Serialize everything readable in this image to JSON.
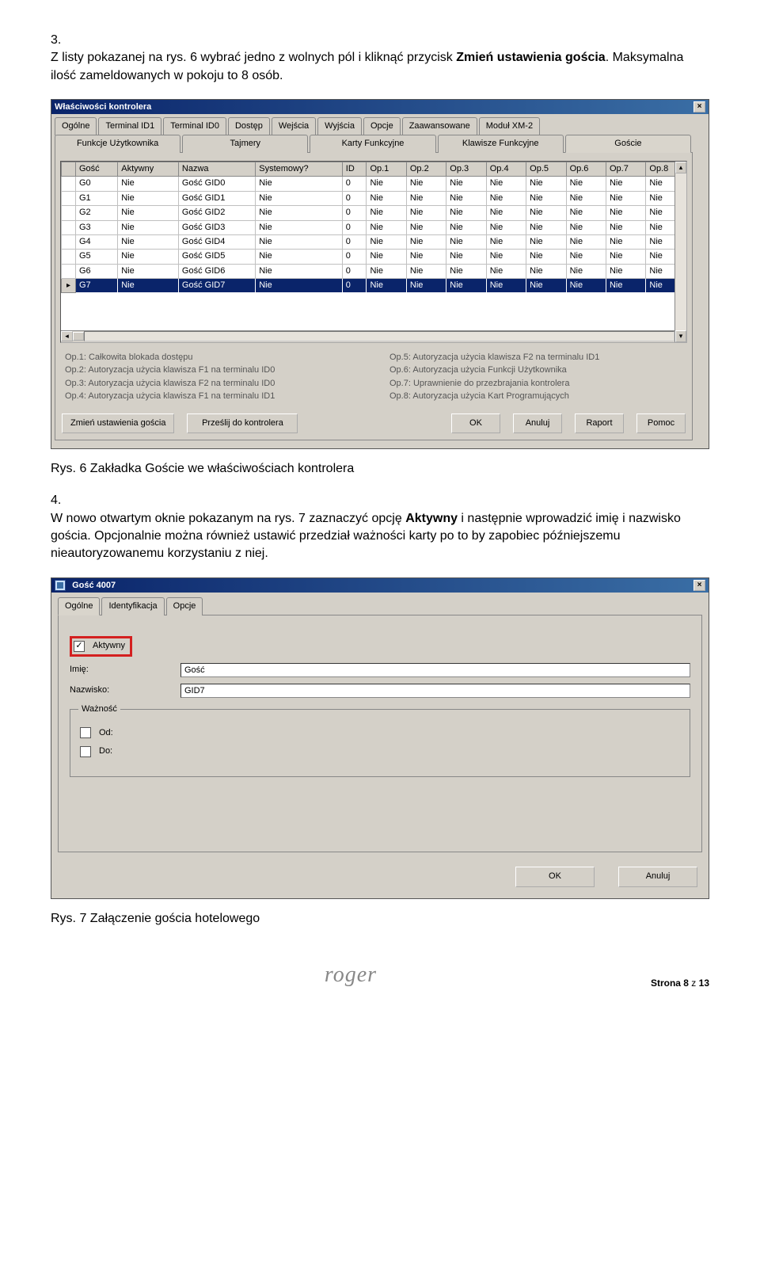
{
  "instr3": {
    "num": "3.",
    "text_a": "Z listy pokazanej na rys. 6 wybrać jedno z wolnych pól i kliknąć przycisk ",
    "bold": "Zmień ustawienia gościa",
    "text_b": ". Maksymalna ilość zameldowanych w pokoju to 8 osób."
  },
  "win1": {
    "title": "Właściwości kontrolera",
    "tabs_row1": [
      "Ogólne",
      "Terminal ID1",
      "Terminal ID0",
      "Dostęp",
      "Wejścia",
      "Wyjścia",
      "Opcje",
      "Zaawansowane",
      "Moduł XM-2"
    ],
    "tabs_row2": [
      "Funkcje Użytkownika",
      "Tajmery",
      "Karty Funkcyjne",
      "Klawisze Funkcyjne",
      "Goście"
    ],
    "active_tab": "Goście",
    "headers": [
      "",
      "Gość",
      "Aktywny",
      "Nazwa",
      "Systemowy?",
      "ID",
      "Op.1",
      "Op.2",
      "Op.3",
      "Op.4",
      "Op.5",
      "Op.6",
      "Op.7",
      "Op.8"
    ],
    "rows": [
      {
        "mark": "",
        "g": "G0",
        "a": "Nie",
        "n": "Gość GID0",
        "s": "Nie",
        "id": "0",
        "ops": [
          "Nie",
          "Nie",
          "Nie",
          "Nie",
          "Nie",
          "Nie",
          "Nie",
          "Nie"
        ],
        "sel": false
      },
      {
        "mark": "",
        "g": "G1",
        "a": "Nie",
        "n": "Gość GID1",
        "s": "Nie",
        "id": "0",
        "ops": [
          "Nie",
          "Nie",
          "Nie",
          "Nie",
          "Nie",
          "Nie",
          "Nie",
          "Nie"
        ],
        "sel": false
      },
      {
        "mark": "",
        "g": "G2",
        "a": "Nie",
        "n": "Gość GID2",
        "s": "Nie",
        "id": "0",
        "ops": [
          "Nie",
          "Nie",
          "Nie",
          "Nie",
          "Nie",
          "Nie",
          "Nie",
          "Nie"
        ],
        "sel": false
      },
      {
        "mark": "",
        "g": "G3",
        "a": "Nie",
        "n": "Gość GID3",
        "s": "Nie",
        "id": "0",
        "ops": [
          "Nie",
          "Nie",
          "Nie",
          "Nie",
          "Nie",
          "Nie",
          "Nie",
          "Nie"
        ],
        "sel": false
      },
      {
        "mark": "",
        "g": "G4",
        "a": "Nie",
        "n": "Gość GID4",
        "s": "Nie",
        "id": "0",
        "ops": [
          "Nie",
          "Nie",
          "Nie",
          "Nie",
          "Nie",
          "Nie",
          "Nie",
          "Nie"
        ],
        "sel": false
      },
      {
        "mark": "",
        "g": "G5",
        "a": "Nie",
        "n": "Gość GID5",
        "s": "Nie",
        "id": "0",
        "ops": [
          "Nie",
          "Nie",
          "Nie",
          "Nie",
          "Nie",
          "Nie",
          "Nie",
          "Nie"
        ],
        "sel": false
      },
      {
        "mark": "",
        "g": "G6",
        "a": "Nie",
        "n": "Gość GID6",
        "s": "Nie",
        "id": "0",
        "ops": [
          "Nie",
          "Nie",
          "Nie",
          "Nie",
          "Nie",
          "Nie",
          "Nie",
          "Nie"
        ],
        "sel": false
      },
      {
        "mark": "▸",
        "g": "G7",
        "a": "Nie",
        "n": "Gość GID7",
        "s": "Nie",
        "id": "0",
        "ops": [
          "Nie",
          "Nie",
          "Nie",
          "Nie",
          "Nie",
          "Nie",
          "Nie",
          "Nie"
        ],
        "sel": true
      }
    ],
    "legend_left": [
      "Op.1: Całkowita blokada dostępu",
      "Op.2: Autoryzacja użycia klawisza F1 na terminalu ID0",
      "Op.3: Autoryzacja użycia klawisza F2 na terminalu ID0",
      "Op.4: Autoryzacja użycia klawisza F1 na terminalu ID1"
    ],
    "legend_right": [
      "Op.5: Autoryzacja użycia klawisza F2 na terminalu ID1",
      "Op.6: Autoryzacja użycia Funkcji Użytkownika",
      "Op.7: Uprawnienie do przezbrajania kontrolera",
      "Op.8: Autoryzacja użycia Kart Programujących"
    ],
    "buttons": {
      "change": "Zmień ustawienia gościa",
      "send": "Prześlij do kontrolera",
      "ok": "OK",
      "cancel": "Anuluj",
      "report": "Raport",
      "help": "Pomoc"
    }
  },
  "caption6": "Rys. 6 Zakładka Goście we właściwościach kontrolera",
  "instr4": {
    "num": "4.",
    "text_a": "W nowo otwartym oknie pokazanym na rys. 7 zaznaczyć opcję ",
    "bold": "Aktywny",
    "text_b": " i następnie wprowadzić imię i nazwisko gościa. Opcjonalnie można również ustawić przedział ważności karty po to by zapobiec późniejszemu nieautoryzowanemu korzystaniu z niej."
  },
  "win2": {
    "title": "Gość 4007",
    "tabs": [
      "Ogólne",
      "Identyfikacja",
      "Opcje"
    ],
    "active_tab": "Ogólne",
    "chk_active_label": "Aktywny",
    "chk_active_checked": true,
    "imie_label": "Imię:",
    "imie_value": "Gość",
    "nazwisko_label": "Nazwisko:",
    "nazwisko_value": "GID7",
    "validity_title": "Ważność",
    "od_label": "Od:",
    "do_label": "Do:",
    "ok": "OK",
    "cancel": "Anuluj"
  },
  "caption7": "Rys. 7 Załączenie gościa hotelowego",
  "footer": {
    "brand": "roger",
    "page_a": "Strona ",
    "page_n": "8",
    "page_b": " z ",
    "page_t": "13"
  }
}
